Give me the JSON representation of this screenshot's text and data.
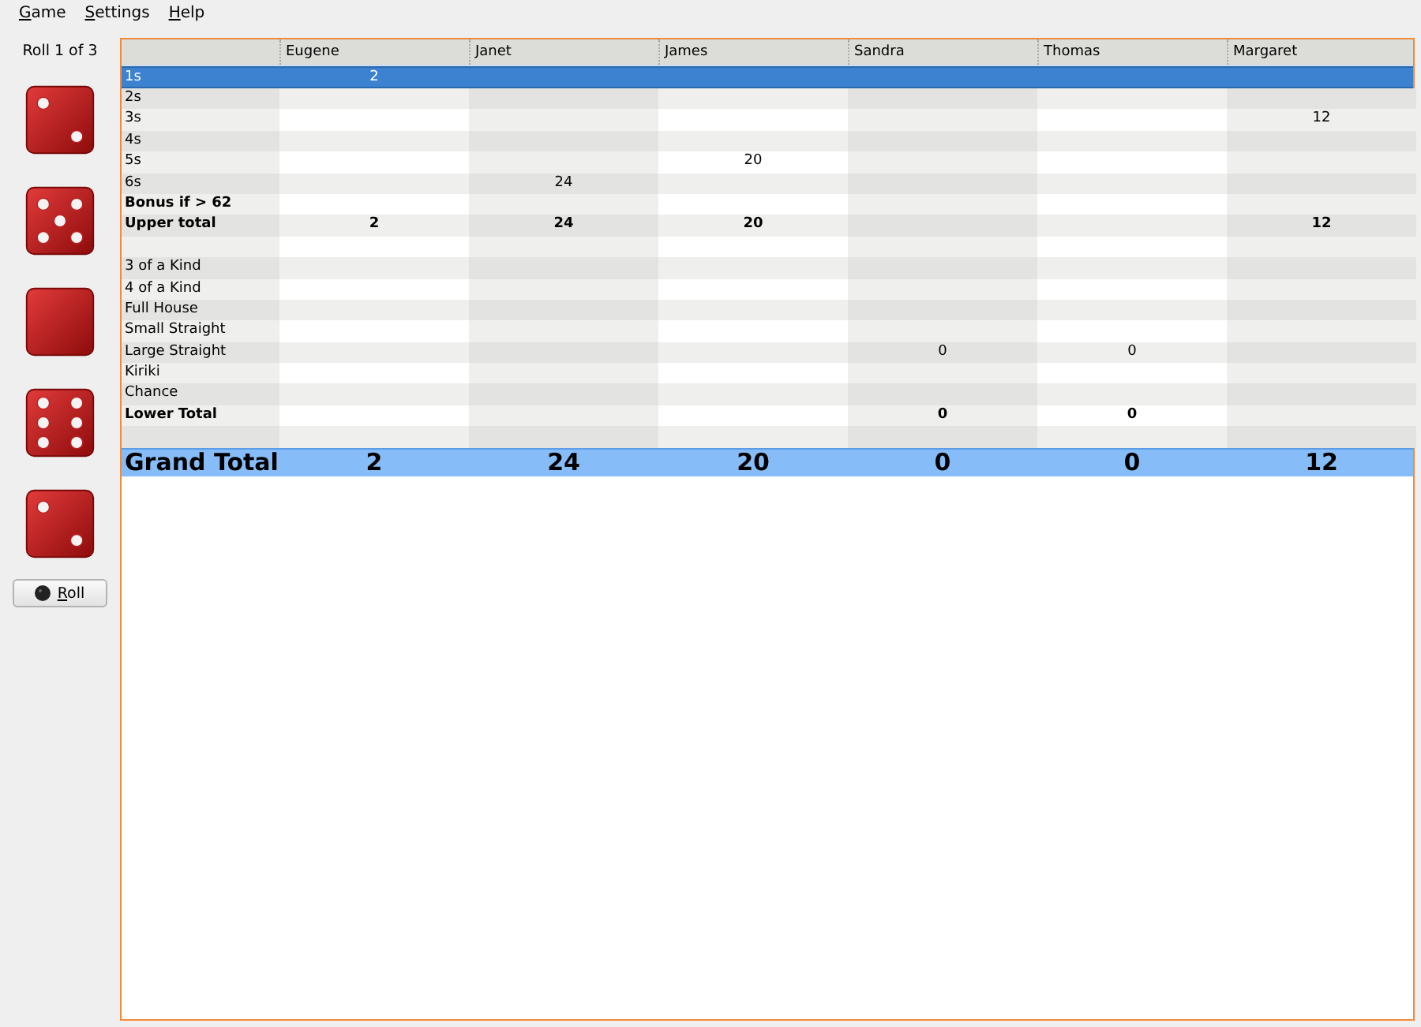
{
  "menu": [
    "Game",
    "Settings",
    "Help"
  ],
  "roll_status": "Roll 1 of 3",
  "dice": [
    {
      "kind": "two"
    },
    {
      "kind": "five"
    },
    {
      "kind": "blank"
    },
    {
      "kind": "six"
    },
    {
      "kind": "two"
    }
  ],
  "roll_button": "Roll",
  "table": {
    "columns": [
      "Eugene",
      "Janet",
      "James",
      "Sandra",
      "Thomas",
      "Margaret"
    ],
    "rows": [
      {
        "kind": "score",
        "label": "1s",
        "selected": true,
        "cells": [
          "2",
          null,
          null,
          null,
          null,
          null
        ]
      },
      {
        "kind": "score",
        "label": "2s",
        "selected": false,
        "cells": [
          null,
          null,
          null,
          null,
          null,
          null
        ]
      },
      {
        "kind": "score",
        "label": "3s",
        "selected": false,
        "cells": [
          null,
          null,
          null,
          null,
          null,
          "12"
        ]
      },
      {
        "kind": "score",
        "label": "4s",
        "selected": false,
        "cells": [
          null,
          null,
          null,
          null,
          null,
          null
        ]
      },
      {
        "kind": "score",
        "label": "5s",
        "selected": false,
        "cells": [
          null,
          null,
          "20",
          null,
          null,
          null
        ]
      },
      {
        "kind": "score",
        "label": "6s",
        "selected": false,
        "cells": [
          null,
          "24",
          null,
          null,
          null,
          null
        ]
      },
      {
        "kind": "total",
        "label": "Bonus if > 62",
        "selected": false,
        "cells": [
          null,
          null,
          null,
          null,
          null,
          null
        ]
      },
      {
        "kind": "total",
        "label": "Upper total",
        "selected": false,
        "cells": [
          "2",
          "24",
          "20",
          null,
          null,
          "12"
        ]
      },
      {
        "kind": "spacer",
        "selected": false
      },
      {
        "kind": "score",
        "label": "3 of a Kind",
        "selected": false,
        "cells": [
          null,
          null,
          null,
          null,
          null,
          null
        ]
      },
      {
        "kind": "score",
        "label": "4 of a Kind",
        "selected": false,
        "cells": [
          null,
          null,
          null,
          null,
          null,
          null
        ]
      },
      {
        "kind": "score",
        "label": "Full House",
        "selected": false,
        "cells": [
          null,
          null,
          null,
          null,
          null,
          null
        ]
      },
      {
        "kind": "score",
        "label": "Small Straight",
        "selected": false,
        "cells": [
          null,
          null,
          null,
          null,
          null,
          null
        ]
      },
      {
        "kind": "score",
        "label": "Large Straight",
        "selected": false,
        "cells": [
          null,
          null,
          null,
          "0",
          "0",
          null
        ]
      },
      {
        "kind": "score",
        "label": "Kiriki",
        "selected": false,
        "cells": [
          null,
          null,
          null,
          null,
          null,
          null
        ]
      },
      {
        "kind": "score",
        "label": "Chance",
        "selected": false,
        "cells": [
          null,
          null,
          null,
          null,
          null,
          null
        ]
      },
      {
        "kind": "total",
        "label": "Lower Total",
        "selected": false,
        "cells": [
          null,
          null,
          null,
          "0",
          "0",
          null
        ]
      },
      {
        "kind": "spacer",
        "selected": false
      },
      {
        "kind": "grand",
        "label": "Grand Total",
        "selected": false,
        "cells": [
          "2",
          "24",
          "20",
          "0",
          "0",
          "12"
        ]
      }
    ]
  }
}
